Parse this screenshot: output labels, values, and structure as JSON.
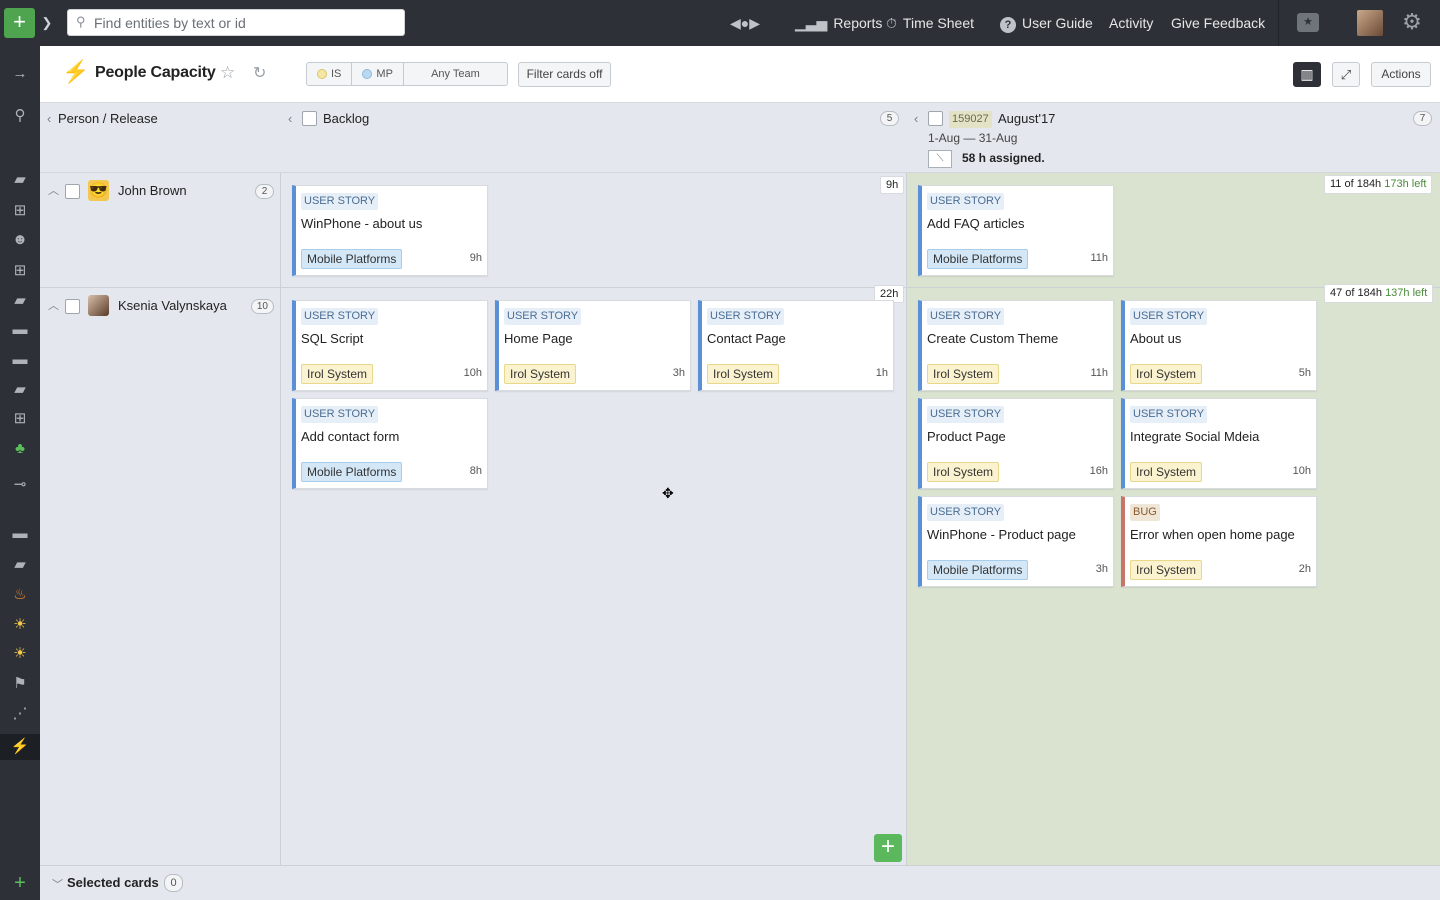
{
  "topbar": {
    "search_placeholder": "Find entities by text or id",
    "nav": [
      {
        "label": "Reports",
        "icon": "bar-chart-icon"
      },
      {
        "label": "Time Sheet",
        "icon": "stopwatch-icon"
      },
      {
        "label": "User Guide",
        "icon": "question-icon"
      },
      {
        "label": "Activity",
        "icon": ""
      },
      {
        "label": "Give Feedback",
        "icon": ""
      }
    ]
  },
  "header": {
    "title": "People Capacity",
    "filters": {
      "is_label": "IS",
      "mp_label": "MP",
      "team_label": "Any Team",
      "filter_cards_label": "Filter cards off",
      "actions_label": "Actions"
    },
    "colors": {
      "is": "#f4e7a3",
      "mp": "#b9d8f2"
    }
  },
  "board": {
    "axis_label": "Person / Release",
    "backlog": {
      "title": "Backlog",
      "count": "5"
    },
    "release": {
      "id": "159027",
      "title": "August'17",
      "count": "7",
      "dates": "1-Aug — 31-Aug",
      "assigned": "58 h assigned."
    },
    "rows": [
      {
        "name": "John Brown",
        "count": "2",
        "backlog_hours": "9h",
        "capacity": "11 of 184h",
        "capacity_left": "173h left",
        "backlog_cards": [
          {
            "type": "USER STORY",
            "title": "WinPhone - about us",
            "tag": "Mobile Platforms",
            "tag_kind": "mobile",
            "effort": "9h"
          }
        ],
        "release_cards": [
          {
            "type": "USER STORY",
            "title": "Add FAQ articles",
            "tag": "Mobile Platforms",
            "tag_kind": "mobile",
            "effort": "11h"
          }
        ]
      },
      {
        "name": "Ksenia Valynskaya",
        "count": "10",
        "backlog_hours": "22h",
        "capacity": "47 of 184h",
        "capacity_left": "137h left",
        "backlog_cards": [
          {
            "type": "USER STORY",
            "title": "SQL Script",
            "tag": "Irol System",
            "tag_kind": "irol",
            "effort": "10h"
          },
          {
            "type": "USER STORY",
            "title": "Home Page",
            "tag": "Irol System",
            "tag_kind": "irol",
            "effort": "3h"
          },
          {
            "type": "USER STORY",
            "title": "Contact Page",
            "tag": "Irol System",
            "tag_kind": "irol",
            "effort": "1h"
          },
          {
            "type": "USER STORY",
            "title": "Add contact form",
            "tag": "Mobile Platforms",
            "tag_kind": "mobile",
            "effort": "8h"
          }
        ],
        "release_cards": [
          {
            "type": "USER STORY",
            "title": "Create Custom Theme",
            "tag": "Irol System",
            "tag_kind": "irol",
            "effort": "11h"
          },
          {
            "type": "USER STORY",
            "title": "About us",
            "tag": "Irol System",
            "tag_kind": "irol",
            "effort": "5h"
          },
          {
            "type": "USER STORY",
            "title": "Product Page",
            "tag": "Irol System",
            "tag_kind": "irol",
            "effort": "16h"
          },
          {
            "type": "USER STORY",
            "title": "Integrate Social Mdeia",
            "tag": "Irol System",
            "tag_kind": "irol",
            "effort": "10h"
          },
          {
            "type": "USER STORY",
            "title": "WinPhone - Product page",
            "tag": "Mobile Platforms",
            "tag_kind": "mobile",
            "effort": "3h"
          },
          {
            "type": "BUG",
            "title": "Error when open home page",
            "tag": "Irol System",
            "tag_kind": "irol",
            "effort": "2h"
          }
        ]
      }
    ]
  },
  "footer": {
    "label": "Selected cards",
    "count": "0"
  }
}
